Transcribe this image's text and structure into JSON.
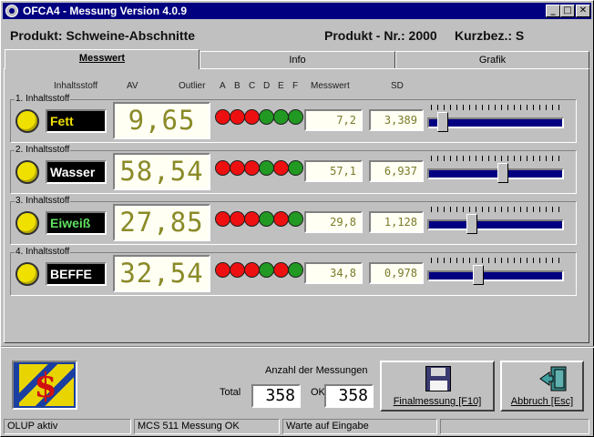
{
  "window": {
    "title": "OFCA4 - Messung Version 4.0.9",
    "min_glyph": "_",
    "max_glyph": "□",
    "close_glyph": "✕"
  },
  "header": {
    "product_label": "Produkt: Schweine-Abschnitte",
    "product_nr": "Produkt - Nr.: 2000",
    "short_name": "Kurzbez.: S"
  },
  "tabs": [
    "Messwert",
    "Info",
    "Grafik"
  ],
  "columns": {
    "ingredient": "Inhaltsstoff",
    "av": "AV",
    "outlier": "Outlier",
    "a": "A",
    "b": "B",
    "c": "C",
    "d": "D",
    "e": "E",
    "f": "F",
    "measure": "Messwert",
    "sd": "SD"
  },
  "rows": [
    {
      "group": "1. Inhaltsstoff",
      "name": "Fett",
      "name_color": "#f0e000",
      "av": "9,65",
      "outlier": [
        "red",
        "red",
        "red",
        "green",
        "green",
        "green"
      ],
      "messwert": "7,2",
      "sd": "3,389",
      "slider": 0.05
    },
    {
      "group": "2. Inhaltsstoff",
      "name": "Wasser",
      "name_color": "#ffffff",
      "av": "58,54",
      "outlier": [
        "red",
        "red",
        "red",
        "green",
        "red",
        "green"
      ],
      "messwert": "57,1",
      "sd": "6,937",
      "slider": 0.56
    },
    {
      "group": "3. Inhaltsstoff",
      "name": "Eiweiß",
      "name_color": "#60e060",
      "av": "27,85",
      "outlier": [
        "red",
        "red",
        "red",
        "green",
        "red",
        "green"
      ],
      "messwert": "29,8",
      "sd": "1,128",
      "slider": 0.3
    },
    {
      "group": "4. Inhaltsstoff",
      "name": "BEFFE",
      "name_color": "#ffffff",
      "av": "32,54",
      "outlier": [
        "red",
        "red",
        "red",
        "green",
        "red",
        "green"
      ],
      "messwert": "34,8",
      "sd": "0,978",
      "slider": 0.35
    }
  ],
  "colors": {
    "red": "#ee1010",
    "green": "#229922",
    "lamp": "#f0e000",
    "value_text": "#8a8a28",
    "title_bg": "#000080"
  },
  "footer": {
    "anzahl_label": "Anzahl der Messungen",
    "total_label": "Total",
    "total_value": "358",
    "ok_label": "OK",
    "ok_value": "358",
    "final_button": "Finalmessung [F10]",
    "cancel_button": "Abbruch [Esc]"
  },
  "status": [
    "OLUP aktiv",
    "MCS 511 Messung OK",
    "Warte auf Eingabe",
    ""
  ]
}
